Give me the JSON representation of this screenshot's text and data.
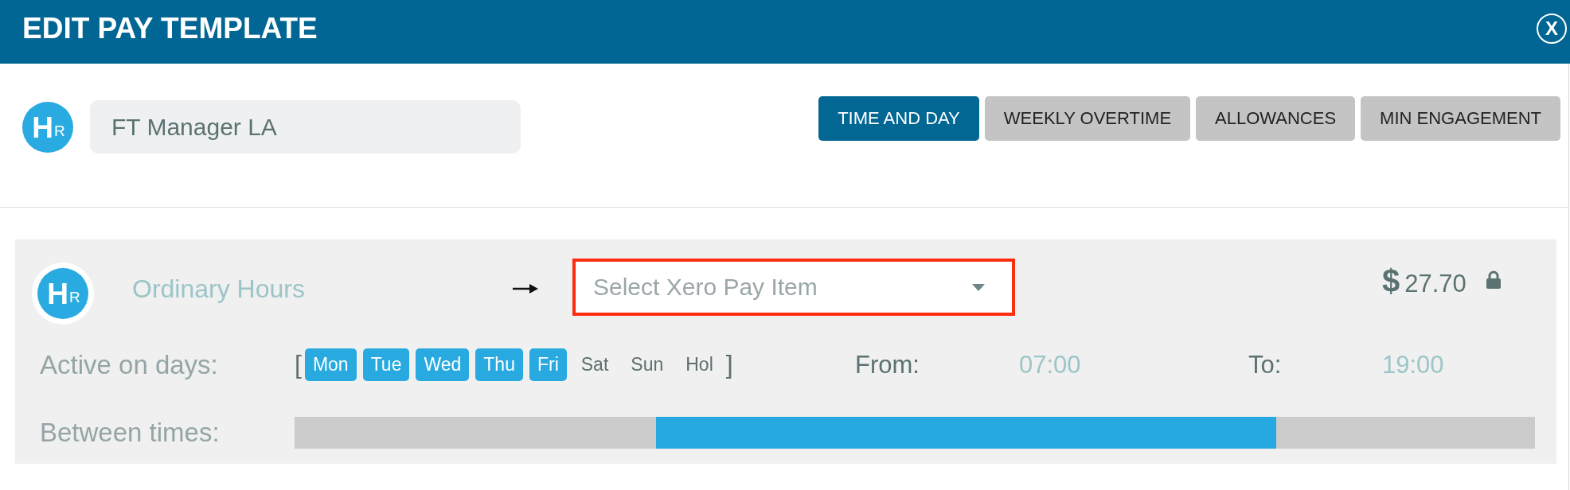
{
  "window": {
    "title": "EDIT PAY TEMPLATE",
    "close_button": {
      "label": "X"
    }
  },
  "template": {
    "logo": {
      "major": "H",
      "minor": "R"
    },
    "name_field": {
      "value": "FT Manager LA"
    }
  },
  "tabs": [
    {
      "label": "TIME AND DAY",
      "selected": true
    },
    {
      "label": "WEEKLY OVERTIME",
      "selected": false
    },
    {
      "label": "ALLOWANCES",
      "selected": false
    },
    {
      "label": "MIN ENGAGEMENT",
      "selected": false
    }
  ],
  "rules": [
    {
      "logo": {
        "major": "H",
        "minor": "R"
      },
      "name": "Ordinary Hours",
      "pay_item": {
        "placeholder": "Select Xero Pay Item",
        "highlighted": true
      },
      "currency": "$",
      "rate": "27.70",
      "locked": true,
      "days_label": "Active on days:",
      "open_bracket": "[",
      "days": [
        {
          "label": "Mon",
          "selected": true
        },
        {
          "label": "Tue",
          "selected": true
        },
        {
          "label": "Wed",
          "selected": true
        },
        {
          "label": "Thu",
          "selected": true
        },
        {
          "label": "Fri",
          "selected": true
        },
        {
          "label": "Sat",
          "selected": false
        },
        {
          "label": "Sun",
          "selected": false
        },
        {
          "label": "Hol",
          "selected": false
        }
      ],
      "close_bracket": "]",
      "from_label": "From:",
      "from": "07:00",
      "to_label": "To:",
      "to": "19:00",
      "range_label": "Between times:",
      "between_times": {
        "start": {
          "level": 0.2917
        },
        "end": {
          "level": 0.7917
        }
      }
    }
  ]
}
